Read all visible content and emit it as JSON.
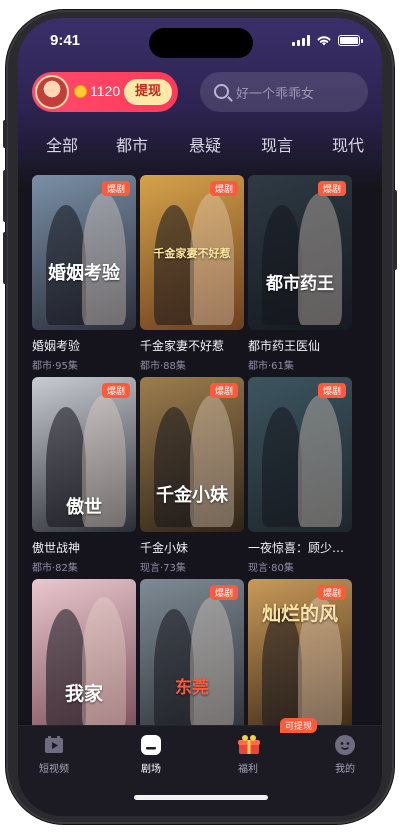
{
  "status_bar": {
    "time": "9:41"
  },
  "wallet": {
    "coins": "1120",
    "withdraw_label": "提现"
  },
  "search": {
    "placeholder": "好一个乖乖女"
  },
  "tabs": [
    {
      "label": "全部",
      "active": true
    },
    {
      "label": "都市",
      "active": false
    },
    {
      "label": "悬疑",
      "active": false
    },
    {
      "label": "现言",
      "active": false
    },
    {
      "label": "现代",
      "active": false
    }
  ],
  "dramas": [
    {
      "title": "婚姻考验",
      "meta": "都市·95集",
      "badge": "爆剧",
      "poster_text": "婚姻考验",
      "colors": [
        "#7a8fa6",
        "#2b2f3a"
      ]
    },
    {
      "title": "千金家妻不好惹",
      "meta": "都市·88集",
      "badge": "爆剧",
      "poster_text": "千金家妻不好惹",
      "colors": [
        "#d6a34a",
        "#6b3f1f"
      ]
    },
    {
      "title": "都市药王医仙",
      "meta": "都市·61集",
      "badge": "爆剧",
      "poster_text": "都市药王",
      "colors": [
        "#2f3a44",
        "#141a20"
      ]
    },
    {
      "title": "傲世战神",
      "meta": "都市·82集",
      "badge": "爆剧",
      "poster_text": "傲世",
      "colors": [
        "#c9ccd2",
        "#2a2d33"
      ]
    },
    {
      "title": "千金小妹",
      "meta": "现言·73集",
      "badge": "爆剧",
      "poster_text": "千金小妹",
      "colors": [
        "#9c7d4e",
        "#2f2418"
      ]
    },
    {
      "title": "一夜惊喜：顾少…",
      "meta": "现言·80集",
      "badge": "爆剧",
      "poster_text": "",
      "colors": [
        "#3d5560",
        "#1d262b"
      ]
    },
    {
      "title": "",
      "meta": "",
      "badge": "",
      "poster_text": "我家",
      "colors": [
        "#e9c7cf",
        "#7a4e57"
      ]
    },
    {
      "title": "",
      "meta": "",
      "badge": "爆剧",
      "poster_text": "东莞",
      "colors": [
        "#7f8a94",
        "#2f3338"
      ]
    },
    {
      "title": "",
      "meta": "",
      "badge": "爆剧",
      "poster_text": "灿烂的风",
      "colors": [
        "#c99a5a",
        "#3a2716"
      ]
    }
  ],
  "bottom_nav": [
    {
      "label": "短视频",
      "icon": "film-icon",
      "active": false
    },
    {
      "label": "剧场",
      "icon": "theater-icon",
      "active": true
    },
    {
      "label": "福利",
      "icon": "gift-icon",
      "active": false,
      "badge": "可提现"
    },
    {
      "label": "我的",
      "icon": "profile-icon",
      "active": false
    }
  ]
}
